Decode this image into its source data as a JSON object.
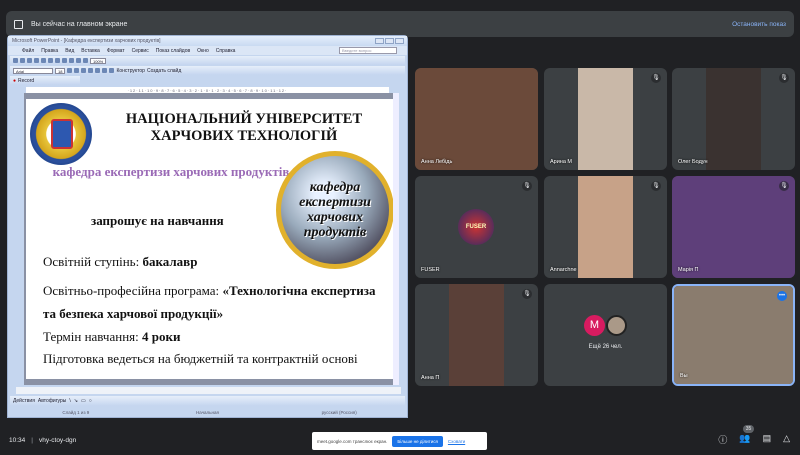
{
  "banner": {
    "text": "Вы сейчас на главном экране",
    "stop": "Остановить показ"
  },
  "ppt": {
    "title": "Microsoft PowerPoint - [Кафедра експертизи харчових продуктів]",
    "menu": [
      "Файл",
      "Правка",
      "Вид",
      "Вставка",
      "Формат",
      "Сервис",
      "Показ слайдов",
      "Окно",
      "Справка"
    ],
    "ask": "Введите вопрос",
    "zoom": "100%",
    "font": "Arial",
    "size": "18",
    "designer": "Конструктор",
    "new_slide": "Создать слайд",
    "record": "Record",
    "ruler": "·12·11·10·9·8·7·6·5·4·3·2·1·0·1·2·3·4·5·6·7·8·9·10·11·12·",
    "actions": "Действия",
    "autoshapes": "Автофигуры",
    "status": {
      "slide": "Слайд 1 из 9",
      "design": "Начальная",
      "lang": "русский (Россия)"
    }
  },
  "slide": {
    "university": "НАЦІОНАЛЬНИЙ УНІВЕРСИТЕТ ХАРЧОВИХ ТЕХНОЛОГІЙ",
    "department": "кафедра експертизи харчових продуктів",
    "globe_text": "кафедра експертизи харчових продуктів",
    "invite": "запрошує на навчання",
    "degree_label": "Освітній ступінь: ",
    "degree": "бакалавр",
    "program_label": "Освітньо-професійна програма: ",
    "program": "«Технологічна експертиза та безпека харчової продукції»",
    "term_label": "Термін навчання: ",
    "term": "4 роки",
    "funding": "Підготовка ведеться на бюджетній та контрактній основі"
  },
  "tiles": [
    {
      "name": "Анна Лебідь",
      "color": "#6b4a3a"
    },
    {
      "name": "Арина М",
      "color": "#c9b8a8"
    },
    {
      "name": "Олег Бодун",
      "color": "#3a3230"
    },
    {
      "name": "FUSER",
      "color": "#3c4043"
    },
    {
      "name": "Annarchne",
      "color": "#c7a288"
    },
    {
      "name": "Марія П",
      "color": "#5e3f7a"
    },
    {
      "name": "Анна П",
      "color": "#5a4038"
    },
    {
      "name": "Ещё 26 чел.",
      "color": "#3c4043"
    },
    {
      "name": "Вы",
      "color": "#8a7c6e"
    }
  ],
  "more_avatar": "M",
  "fuser_logo": "FUSER",
  "bottom": {
    "time": "10:34",
    "code": "vhy-ctoy-dgn",
    "share_text": "meet.google.com транслює екран.",
    "stop_share": "Більше не ділитися",
    "hide": "Сховати",
    "participants": "35"
  }
}
